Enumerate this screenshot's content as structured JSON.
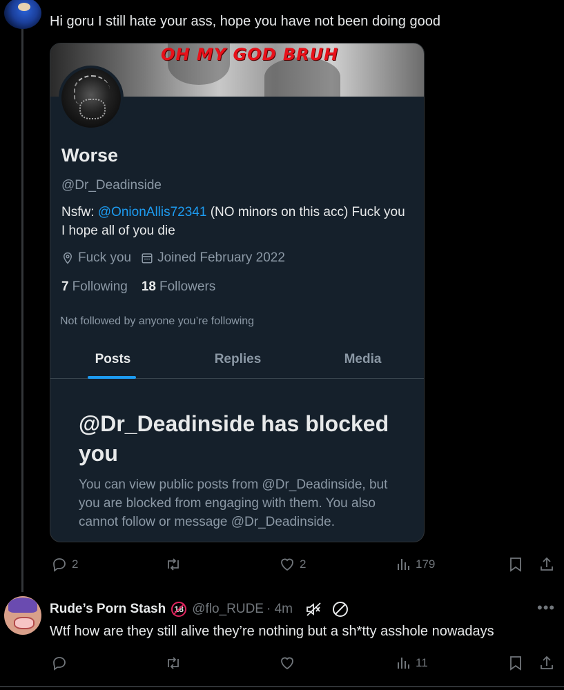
{
  "tweet1": {
    "text": "Hi goru I still hate your ass, hope you have not been doing good"
  },
  "card": {
    "banner_text": "OH MY GOD BRUH",
    "name": "Worse",
    "handle": "@Dr_Deadinside",
    "bio_prefix": "Nsfw: ",
    "bio_mention": "@OnionAllis72341",
    "bio_suffix": " (NO minors on this acc) Fuck you I hope all of you die",
    "location": "Fuck you",
    "joined": "Joined February 2022",
    "following_count": "7",
    "following_label": "Following",
    "followers_count": "18",
    "followers_label": "Followers",
    "not_followed": "Not followed by anyone you’re following",
    "tabs": [
      {
        "label": "Posts",
        "active": true
      },
      {
        "label": "Replies",
        "active": false
      },
      {
        "label": "Media",
        "active": false
      }
    ],
    "blocked_title": "@Dr_Deadinside has blocked you",
    "blocked_body": "You can view public posts from @Dr_Deadinside, but you are blocked from engaging with them. You also cannot follow or message @Dr_Deadinside."
  },
  "tweet1_actions": {
    "replies": "2",
    "reposts": "",
    "likes": "2",
    "views": "179"
  },
  "tweet2": {
    "name": "Rude’s Porn Stash",
    "badge": "18",
    "handle": "@flo_RUDE",
    "time": "· 4m",
    "text": "Wtf how are they still alive they’re nothing but a sh*tty asshole nowadays"
  },
  "tweet2_actions": {
    "replies": "",
    "reposts": "",
    "likes": "",
    "views": "11"
  },
  "colors": {
    "background": "#000000",
    "card": "#15202b",
    "accent": "#1d9bf0",
    "muted": "#71767b",
    "banner_text": "#e8111a"
  }
}
